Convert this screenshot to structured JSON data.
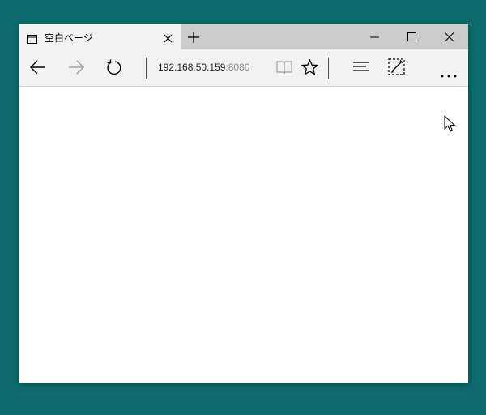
{
  "browser": {
    "tab": {
      "title": "空白ページ",
      "icon": "page-icon"
    },
    "new_tab_icon": "plus-icon",
    "window_controls": [
      "minimize-icon",
      "maximize-icon",
      "close-icon"
    ]
  },
  "toolbar": {
    "back_icon": "back-arrow-icon",
    "forward_icon": "forward-arrow-icon",
    "refresh_icon": "refresh-icon",
    "address": {
      "host": "192.168.50.159",
      "port": ":8080"
    },
    "reading_view_icon": "book-icon",
    "favorite_icon": "star-icon",
    "hub_icon": "hub-icon",
    "web_note_icon": "pen-note-icon",
    "more_icon": "more-icon"
  },
  "colors": {
    "desktop": "#0e6b6e",
    "titlebar": "#cccccc",
    "toolbar": "#f2f2f2",
    "address_port": "#8a8a8a"
  }
}
